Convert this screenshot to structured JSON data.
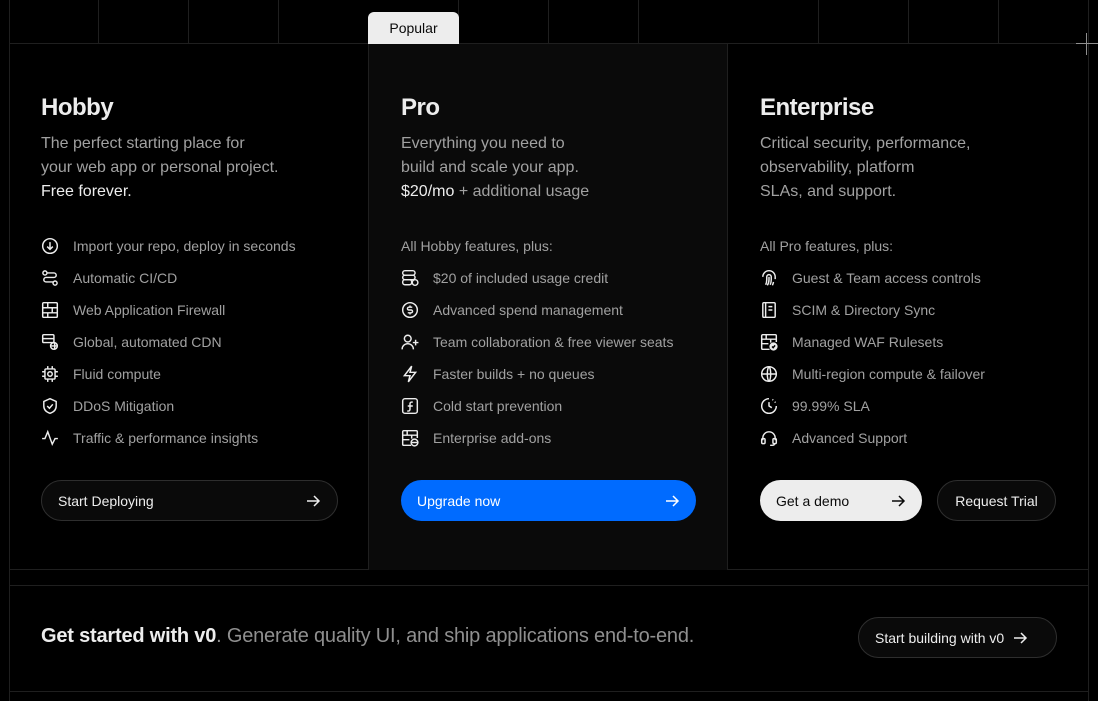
{
  "popular_label": "Popular",
  "plans": {
    "hobby": {
      "name": "Hobby",
      "desc_lines": [
        "The perfect starting place for",
        "your web app or personal project."
      ],
      "desc_strong": "Free forever.",
      "features": [
        {
          "icon": "download-circle-icon",
          "label": "Import your repo, deploy in seconds"
        },
        {
          "icon": "git-flow-icon",
          "label": "Automatic CI/CD"
        },
        {
          "icon": "firewall-icon",
          "label": "Web Application Firewall"
        },
        {
          "icon": "cdn-globe-icon",
          "label": "Global, automated CDN"
        },
        {
          "icon": "chip-icon",
          "label": "Fluid compute"
        },
        {
          "icon": "shield-check-icon",
          "label": "DDoS Mitigation"
        },
        {
          "icon": "pulse-icon",
          "label": "Traffic & performance insights"
        }
      ],
      "cta": "Start Deploying"
    },
    "pro": {
      "name": "Pro",
      "desc_lines": [
        "Everything you need to",
        "build and scale your app."
      ],
      "price": "$20/mo",
      "price_suffix": "+ additional usage",
      "feature_header": "All Hobby features, plus:",
      "features": [
        {
          "icon": "coins-icon",
          "label": "$20 of included usage credit"
        },
        {
          "icon": "dollar-circle-icon",
          "label": "Advanced spend management"
        },
        {
          "icon": "user-plus-icon",
          "label": "Team collaboration & free viewer seats"
        },
        {
          "icon": "lightning-icon",
          "label": "Faster builds + no queues"
        },
        {
          "icon": "function-icon",
          "label": "Cold start prevention"
        },
        {
          "icon": "firewall-globe-icon",
          "label": "Enterprise add-ons"
        }
      ],
      "cta": "Upgrade now"
    },
    "enterprise": {
      "name": "Enterprise",
      "desc_lines": [
        "Critical security, performance,",
        "observability, platform",
        "SLAs, and support."
      ],
      "feature_header": "All Pro features, plus:",
      "features": [
        {
          "icon": "fingerprint-icon",
          "label": "Guest & Team access controls"
        },
        {
          "icon": "directory-icon",
          "label": "SCIM & Directory Sync"
        },
        {
          "icon": "firewall-check-icon",
          "label": "Managed WAF Rulesets"
        },
        {
          "icon": "globe-icon",
          "label": "Multi-region compute & failover"
        },
        {
          "icon": "clock-icon",
          "label": "99.99% SLA"
        },
        {
          "icon": "headset-icon",
          "label": "Advanced Support"
        }
      ],
      "cta_primary": "Get a demo",
      "cta_secondary": "Request Trial"
    }
  },
  "cta_bar": {
    "headline_strong": "Get started with v0",
    "headline_rest": ". Generate quality UI, and ship applications end-to-end.",
    "button": "Start building with v0"
  },
  "colors": {
    "accent_blue": "#006bff",
    "background": "#000000",
    "pro_background": "#0a0a0a",
    "text_primary": "#ededed",
    "text_secondary": "#a1a1a1"
  }
}
